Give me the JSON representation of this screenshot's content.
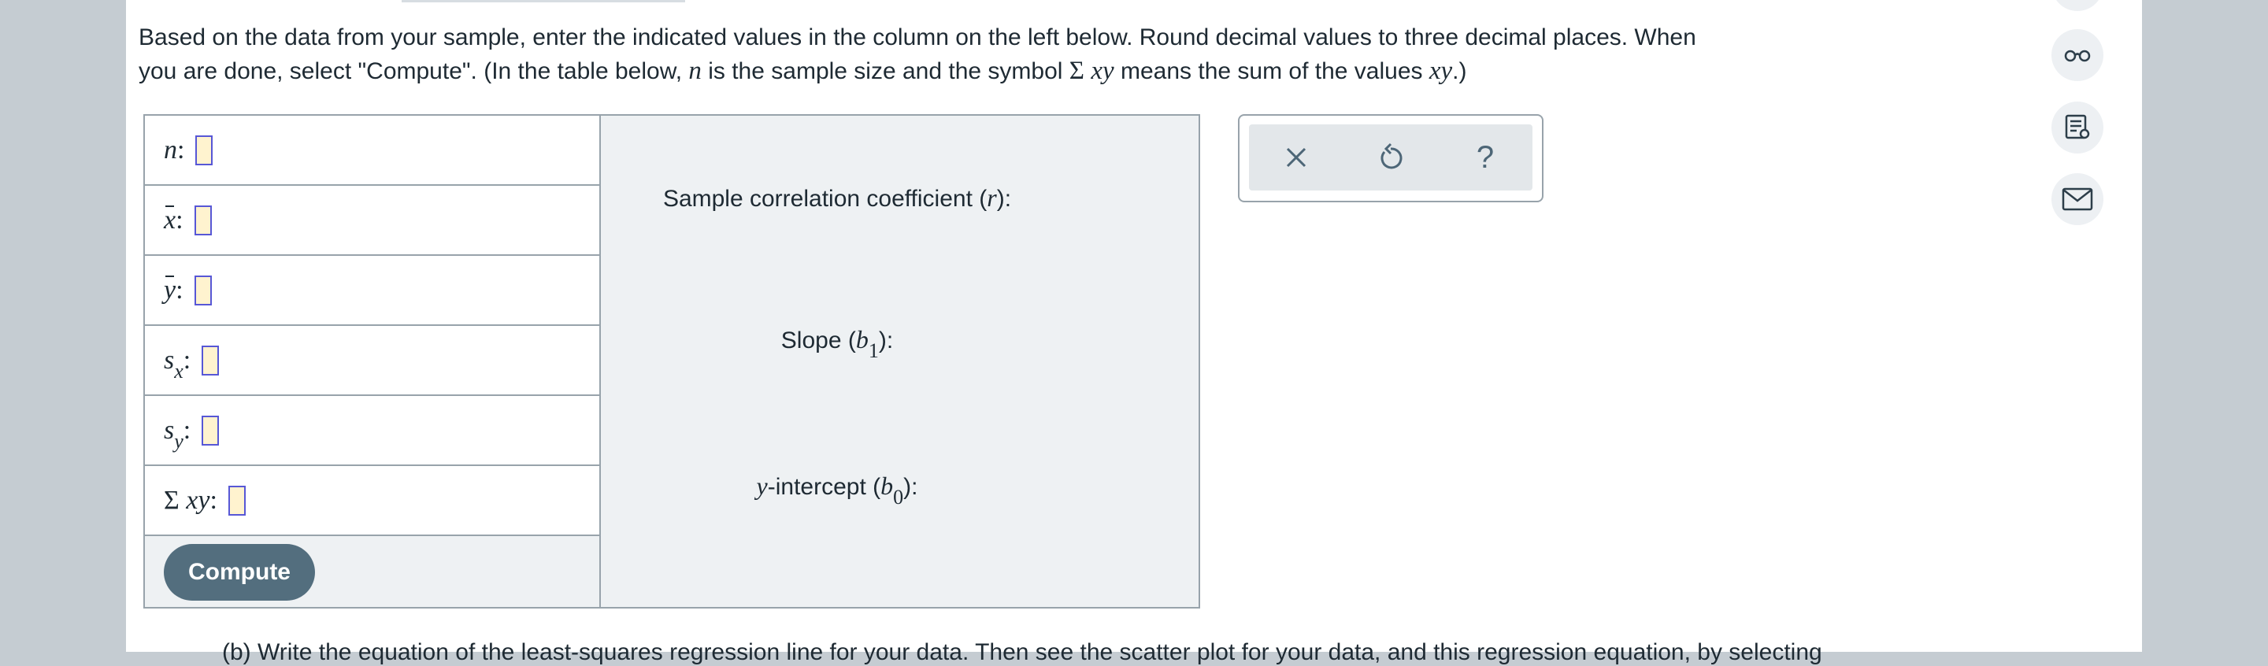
{
  "instructions": {
    "line1": "Based on the data from your sample, enter the indicated values in the column on the left below. Round decimal values to three decimal places. When",
    "line2_a": "you are done, select \"Compute\". (In the table below, ",
    "line2_n": "n",
    "line2_b": " is the sample size and the symbol ",
    "line2_sigma": "Σ",
    "line2_xy": "xy",
    "line2_c": " means the sum of the values ",
    "line2_xy2": "xy",
    "line2_d": ".)"
  },
  "table": {
    "rows": [
      {
        "var": "n",
        "colon": ":"
      },
      {
        "var": "x",
        "colon": ":"
      },
      {
        "var": "y",
        "colon": ":"
      },
      {
        "var": "s",
        "sub": "x",
        "colon": ":"
      },
      {
        "var": "s",
        "sub": "y",
        "colon": ":"
      },
      {
        "sigma": "Σ",
        "var": "xy",
        "colon": ":"
      }
    ],
    "compute_label": "Compute",
    "results": {
      "r_text": "Sample correlation coefficient (",
      "r_var": "r",
      "r_end": "):",
      "slope_text": "Slope (",
      "slope_var": "b",
      "slope_sub": "1",
      "slope_end": "):",
      "intercept_var": "y",
      "intercept_text": "-intercept (",
      "intercept_b": "b",
      "intercept_sub": "0",
      "intercept_end": "):"
    }
  },
  "toolbox": {
    "clear": "×",
    "undo": "↺",
    "help": "?"
  },
  "side_buttons": [
    "glasses-icon",
    "notes-icon",
    "mail-icon"
  ],
  "next_question": "(b) Write the equation of the least-squares regression line for your data. Then see the scatter plot for your data, and this regression equation, by selecting"
}
